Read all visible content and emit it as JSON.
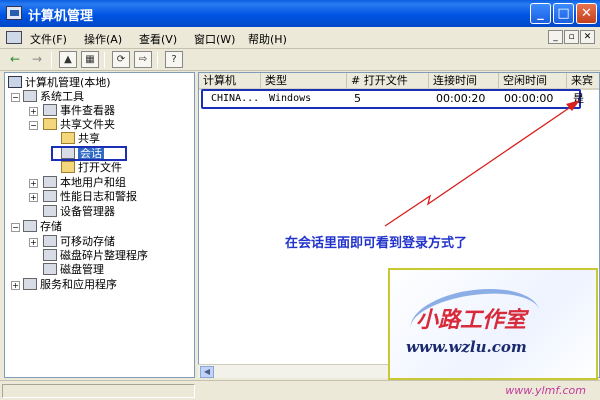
{
  "window": {
    "title": "计算机管理",
    "minimize_glyph": "_",
    "maximize_glyph": "□",
    "close_glyph": "✕"
  },
  "menu": {
    "items": [
      "文件(F)",
      "操作(A)",
      "查看(V)",
      "窗口(W)",
      "帮助(H)"
    ],
    "mdi_buttons": [
      "_",
      "▫",
      "✕"
    ]
  },
  "toolbar": {
    "back": "←",
    "forward": "→",
    "buttons": [
      "▲",
      "▦",
      "⟳",
      "⇨",
      "?"
    ]
  },
  "tree": {
    "root": "计算机管理(本地)",
    "system_tools": "系统工具",
    "event_viewer": "事件查看器",
    "shared_folders": "共享文件夹",
    "shares": "共享",
    "sessions": "会话",
    "open_files": "打开文件",
    "local_users": "本地用户和组",
    "perf_logs": "性能日志和警报",
    "device_manager": "设备管理器",
    "storage": "存储",
    "removable_storage": "可移动存储",
    "defrag": "磁盘碎片整理程序",
    "disk_management": "磁盘管理",
    "services_apps": "服务和应用程序",
    "plus": "+",
    "minus": "−"
  },
  "list": {
    "columns": [
      "计算机",
      "类型",
      "# 打开文件",
      "连接时间",
      "空闲时间",
      "来宾"
    ],
    "rows": [
      [
        "CHINA...",
        "Windows",
        "5",
        "00:00:20",
        "00:00:00",
        "是"
      ]
    ]
  },
  "annotation": "在会话里面即可看到登录方式了",
  "watermark": {
    "brand_cn": "小路工作室",
    "url": "www.wzlu.com"
  },
  "scrollbar": {
    "left_arrow": "◀"
  },
  "statusbar": {
    "site": "www.ylmf.com"
  },
  "colors": {
    "titlebar": "#0054e3",
    "annotation": "#2233cc",
    "highlight_box": "#1a2fb5",
    "arrow": "#d81e1e"
  }
}
